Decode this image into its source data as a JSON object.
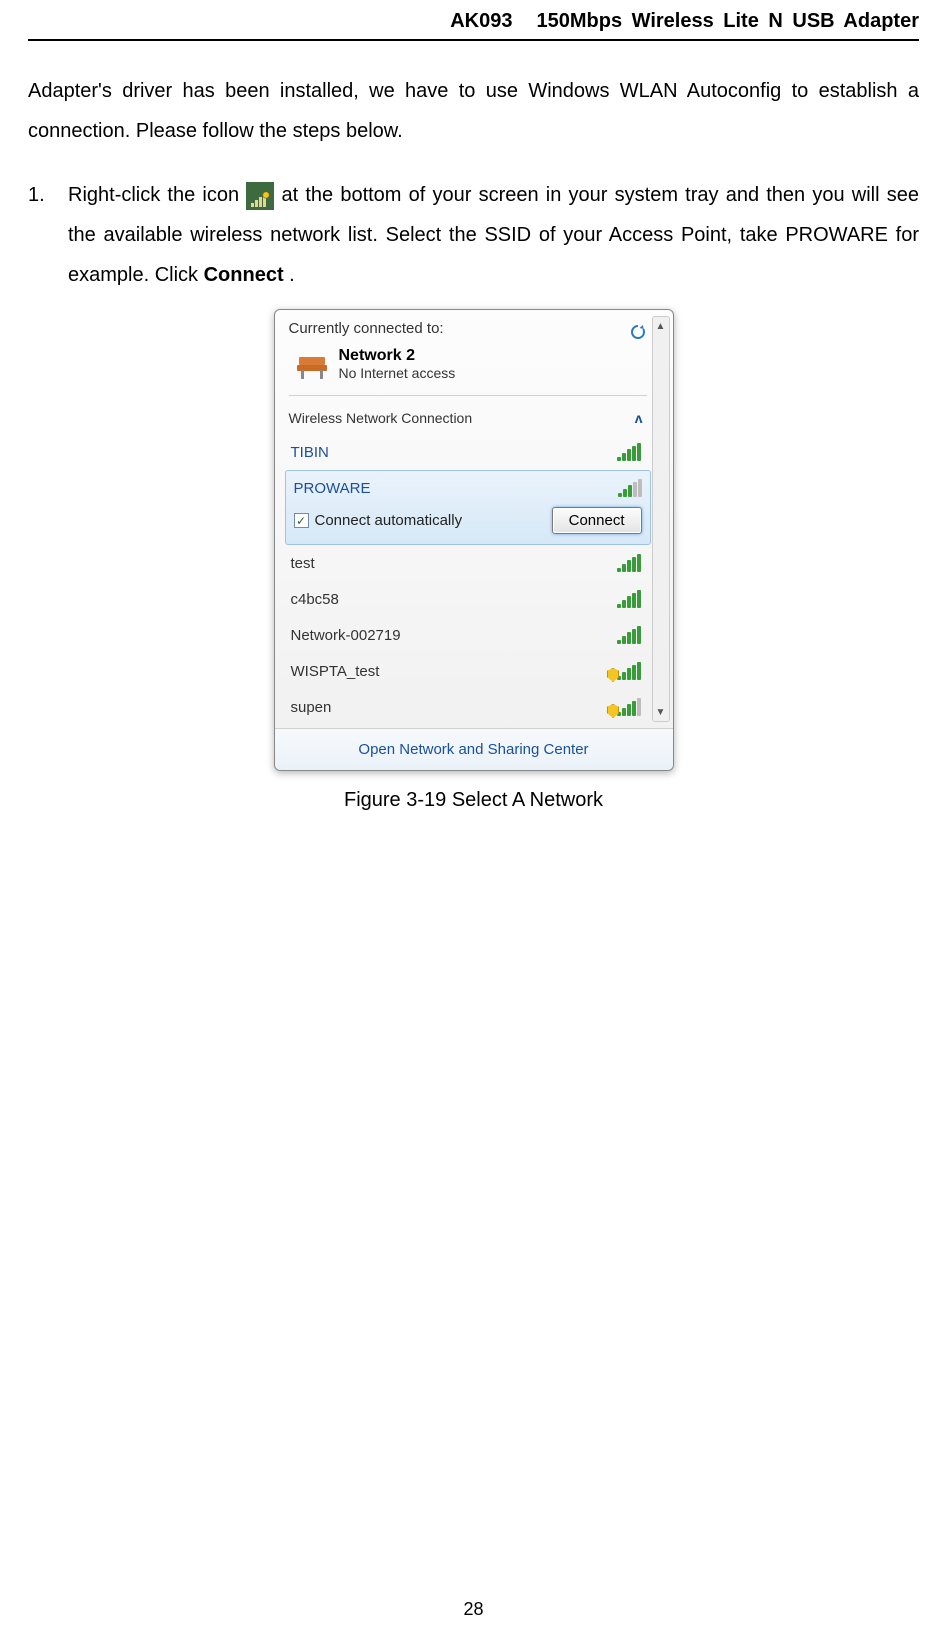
{
  "header": {
    "model": "AK093",
    "title": "150Mbps Wireless Lite N USB Adapter"
  },
  "intro": "Adapter's driver has been installed, we have to use Windows WLAN Autoconfig to establish a connection. Please follow the steps below.",
  "step1": {
    "number": "1.",
    "pre": "Right-click the icon ",
    "post1": " at the bottom of your screen in your system tray and then you will see the available wireless network list. Select the SSID of your Access Point, take PROWARE for example. Click ",
    "bold": "Connect",
    "post2": "."
  },
  "popup": {
    "currently_connected": "Currently connected to:",
    "network_name": "Network  2",
    "network_sub": "No Internet access",
    "wnc_label": "Wireless Network Connection",
    "connect_auto_label": "Connect automatically",
    "connect_button": "Connect",
    "footer_link": "Open Network and Sharing Center",
    "networks": {
      "tibin": "TIBIN",
      "proware": "PROWARE",
      "test": "test",
      "c4bc58": "c4bc58",
      "network002719": "Network-002719",
      "wispta": "WISPTA_test",
      "supen": "supen"
    }
  },
  "caption": "Figure 3-19 Select A Network",
  "page_number": "28"
}
